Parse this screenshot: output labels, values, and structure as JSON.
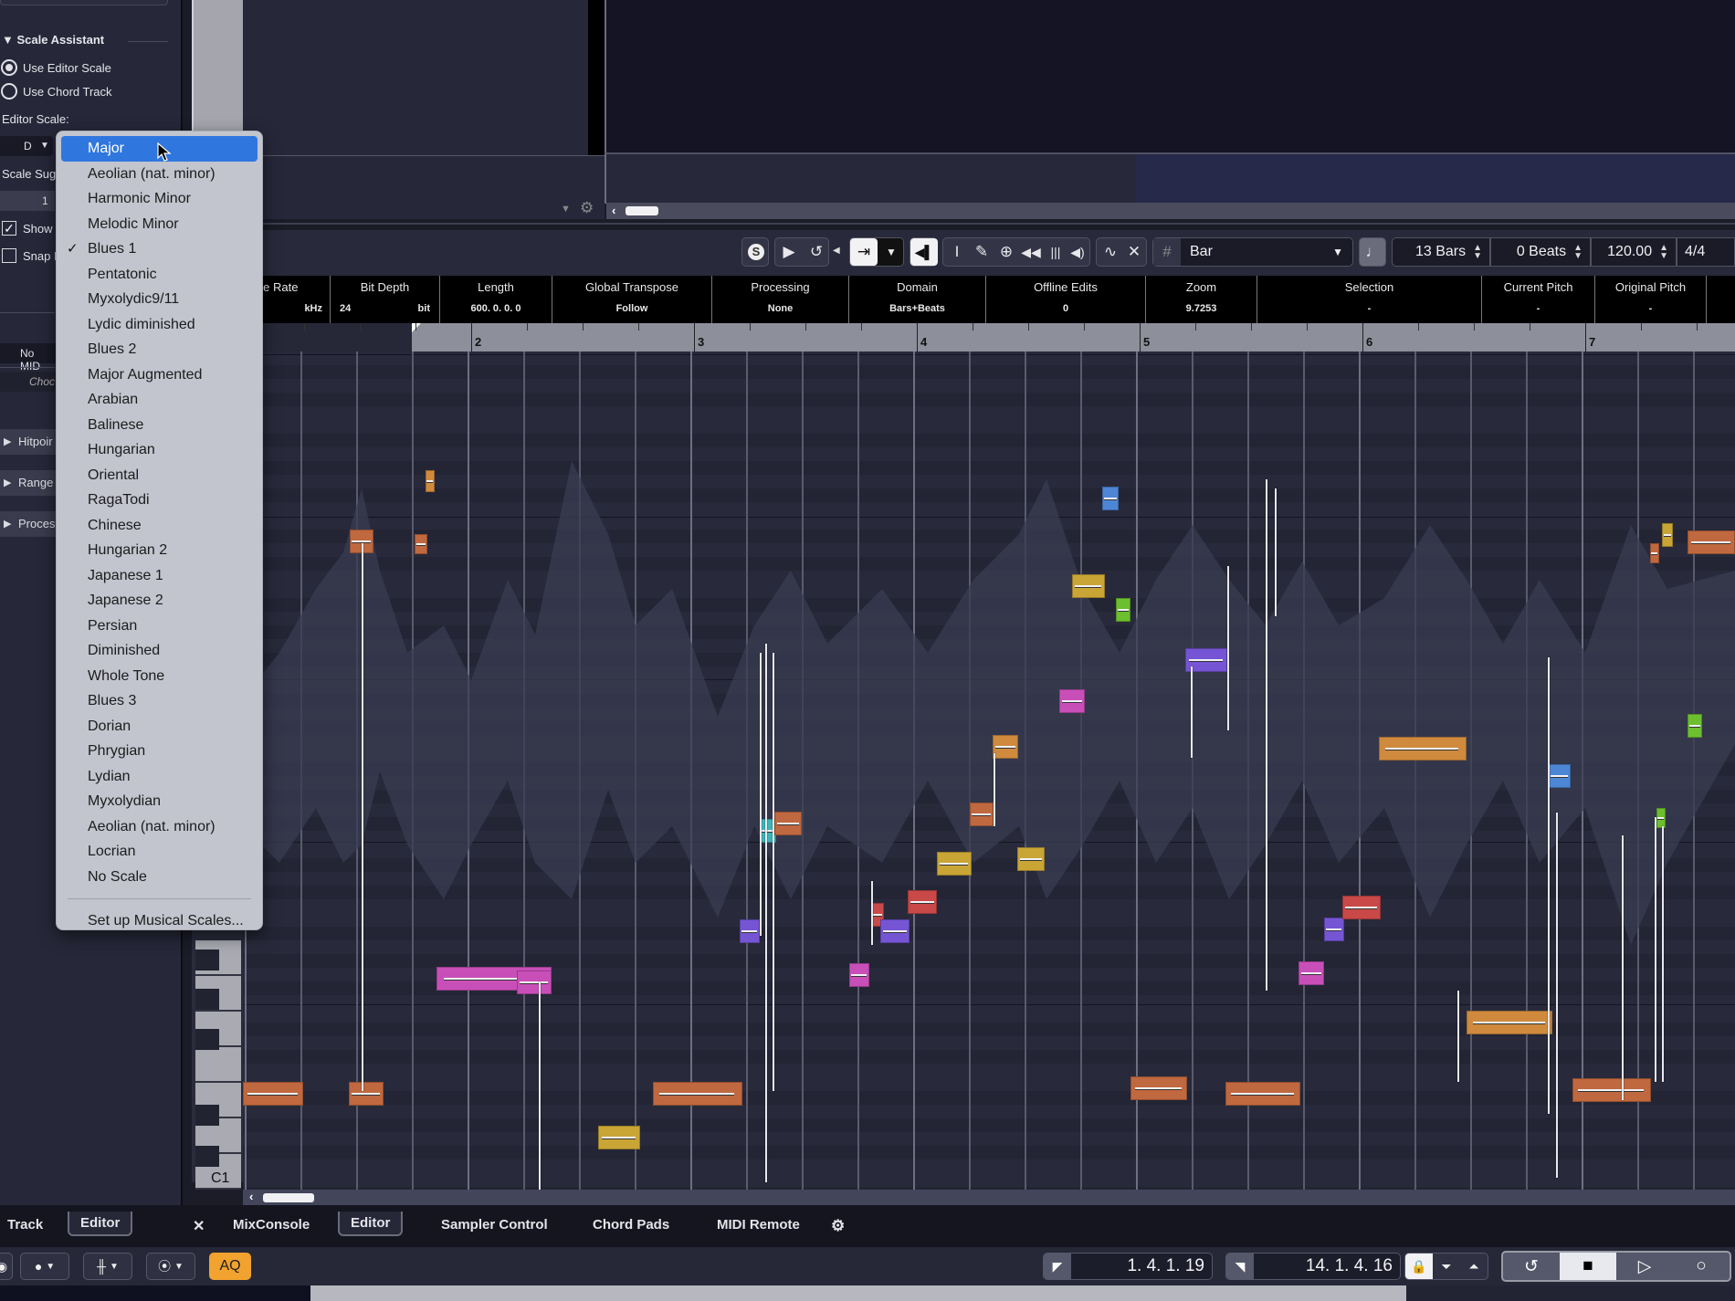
{
  "inspector": {
    "scale_assistant": {
      "title": "Scale Assistant",
      "use_editor_scale": "Use Editor Scale",
      "use_chord_track": "Use Chord Track",
      "selected_mode": "Use Editor Scale",
      "editor_scale_label": "Editor Scale:",
      "root_note": "D",
      "scale_suggestion_label": "Scale Sugg",
      "scale_suggestion_value": "1",
      "show_label": "Show",
      "show_checked": true,
      "snap_label": "Snap I",
      "snap_checked": false,
      "no_midi": "No MID",
      "chord_placeholder": "Choc"
    },
    "sections": [
      {
        "label": "Hitpoir"
      },
      {
        "label": "Range"
      },
      {
        "label": "Proces"
      }
    ]
  },
  "scale_menu": {
    "highlighted": "Major",
    "checked": "Blues 1",
    "items": [
      "Major",
      "Aeolian (nat. minor)",
      "Harmonic Minor",
      "Melodic Minor",
      "Blues 1",
      "Pentatonic",
      "Myxolydic9/11",
      "Lydic diminished",
      "Blues 2",
      "Major Augmented",
      "Arabian",
      "Balinese",
      "Hungarian",
      "Oriental",
      "RagaTodi",
      "Chinese",
      "Hungarian 2",
      "Japanese 1",
      "Japanese 2",
      "Persian",
      "Diminished",
      "Whole Tone",
      "Blues 3",
      "Dorian",
      "Phrygian",
      "Lydian",
      "Myxolydian",
      "Aeolian (nat. minor)",
      "Locrian",
      "No Scale"
    ],
    "setup": "Set up Musical Scales..."
  },
  "toolbar": {
    "icons": [
      "solo-icon",
      "play-icon",
      "loop-icon",
      "auto-scroll-icon",
      "dropdown-icon",
      "acoustic-feedback-icon",
      "select-icon",
      "pencil-icon",
      "zoom-icon",
      "mute-icon",
      "timewarp-icon",
      "speaker-icon",
      "curve-icon",
      "scissors-icon"
    ],
    "grid_type": "Bar",
    "quantize_icon": "note-icon",
    "length_bars": "13 Bars",
    "length_beats": "0 Beats",
    "tempo": "120.00",
    "signature": "4/4"
  },
  "infoline": {
    "columns": [
      {
        "title": "ple Rate",
        "value": "kHz"
      },
      {
        "title": "Bit Depth",
        "value_left": "24",
        "value": "bit"
      },
      {
        "title": "Length",
        "value": "600. 0. 0.  0"
      },
      {
        "title": "Global Transpose",
        "value": "Follow"
      },
      {
        "title": "Processing",
        "value": "None"
      },
      {
        "title": "Domain",
        "value": "Bars+Beats"
      },
      {
        "title": "Offline Edits",
        "value": "0"
      },
      {
        "title": "Zoom",
        "value": "9.7253"
      },
      {
        "title": "Selection",
        "value": "-"
      },
      {
        "title": "Current Pitch",
        "value": "-"
      },
      {
        "title": "Original Pitch",
        "value": "-"
      }
    ]
  },
  "ruler": {
    "bars": [
      "2",
      "3",
      "4",
      "5",
      "6",
      "7"
    ]
  },
  "piano": {
    "lowest_label": "C1"
  },
  "notes": {
    "colors": {
      "orange": "#c0683f",
      "amber": "#cf8a3e",
      "yellow": "#c9a536",
      "magenta": "#c94fb8",
      "purple": "#7555d4",
      "blue": "#4e86d6",
      "red": "#c94848",
      "teal": "#3bb5b8",
      "green": "#6cbf2e"
    }
  },
  "bottom_tabs": {
    "left": [
      "Track",
      "Editor"
    ],
    "left_active": "Editor",
    "main": [
      "MixConsole",
      "Editor",
      "Sampler Control",
      "Chord Pads",
      "MIDI Remote"
    ],
    "main_active": "Editor"
  },
  "statusbar": {
    "aq_label": "AQ",
    "left_locator": "1.  4.  1.  19",
    "right_locator": "14.  1.  4.  16",
    "transport": [
      "cycle",
      "stop",
      "play",
      "record"
    ],
    "active_transport": "stop"
  }
}
